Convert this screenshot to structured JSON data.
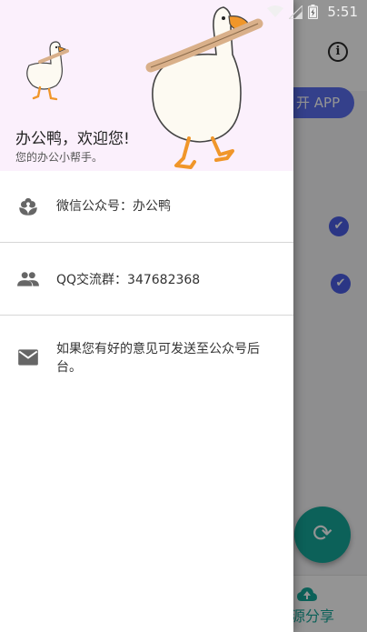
{
  "status_bar": {
    "time": "5:51",
    "icons": [
      "wifi-icon",
      "signal-icon",
      "battery-icon"
    ]
  },
  "background_app": {
    "open_app_label": "开 APP",
    "share_label": "源分享"
  },
  "drawer": {
    "header": {
      "title": "办公鸭，欢迎您!",
      "subtitle": "您的办公小帮手。",
      "background_color": "#fbf0fc"
    },
    "items": [
      {
        "icon": "flower-icon",
        "label": "微信公众号：办公鸭"
      },
      {
        "icon": "group-icon",
        "label": "QQ交流群：347682368"
      },
      {
        "icon": "mail-icon",
        "label": "如果您有好的意见可发送至公众号后台。"
      }
    ]
  },
  "colors": {
    "accent_blue": "#5b6ff0",
    "fab_teal": "#16a89a",
    "icon_gray": "#666666"
  }
}
